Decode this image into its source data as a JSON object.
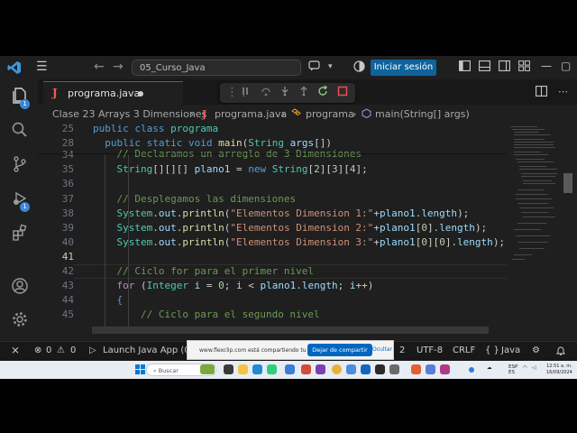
{
  "titlebar": {
    "search_text": "05_Curso_Java",
    "login_label": "Iniciar sesión"
  },
  "activity": {
    "explorer_badge": "1",
    "run_debug_badge": "1"
  },
  "tab": {
    "file_icon": "J",
    "name": "programa.java"
  },
  "breadcrumb": {
    "folder": "Clase 23 Arrays 3 Dimensiones",
    "file_icon": "J",
    "file": "programa.java",
    "class": "programa",
    "method": "main(String[] args)"
  },
  "editor": {
    "active_line": "41",
    "line_numbers": [
      "25",
      "28",
      "34",
      "35",
      "36",
      "37",
      "38",
      "39",
      "40",
      "41",
      "42",
      "43",
      "44",
      "45"
    ]
  },
  "statusbar": {
    "errors": "0",
    "warnings": "0",
    "launch": "Launch Java App (05",
    "spaces": "2",
    "encoding": "UTF-8",
    "eol": "CRLF",
    "lang_icon": "{ }",
    "language": "Java"
  },
  "share": {
    "message": "www.flexclip.com está compartiendo tu pantalla.",
    "stop_label": "Dejar de compartir",
    "hide_label": "Ocultar"
  },
  "taskbar": {
    "search_placeholder": "Buscar",
    "lang_top": "ESP",
    "lang_bottom": "ES",
    "time": "12:51 a. m.",
    "date": "16/09/2024"
  },
  "colors": {
    "accent": "#0e639c",
    "keyword": "#569cd6",
    "type": "#4ec9b0",
    "string": "#ce9178",
    "comment": "#6a9955"
  }
}
